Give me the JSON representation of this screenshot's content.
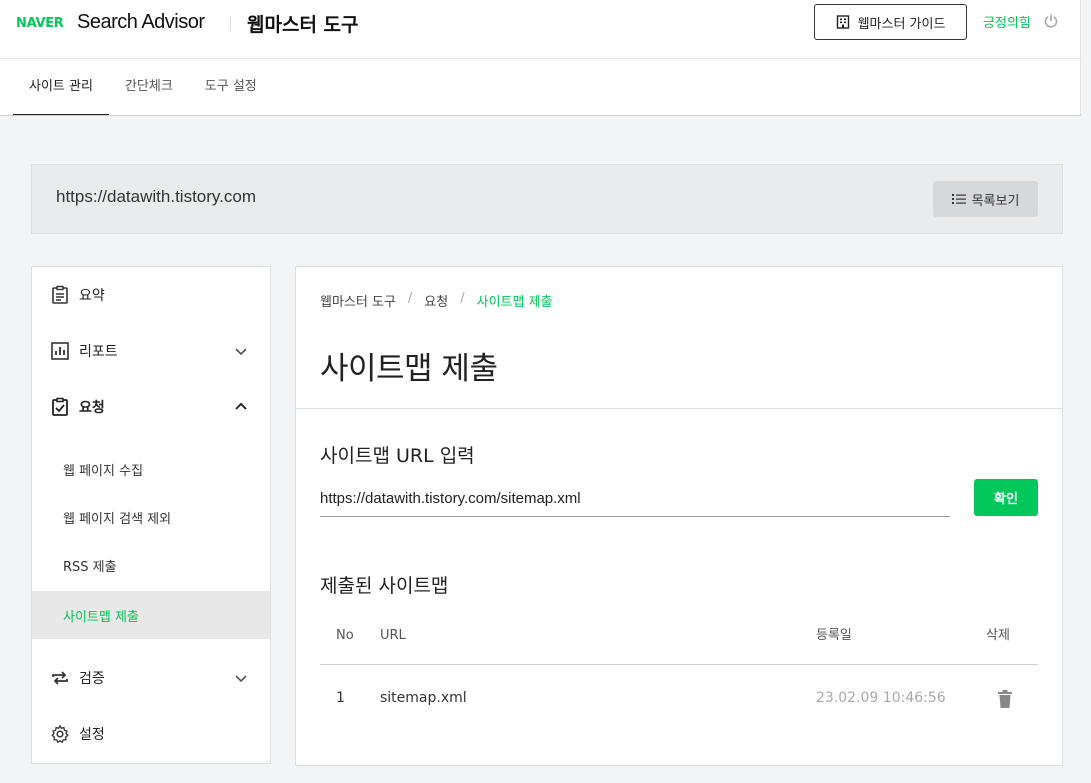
{
  "header": {
    "logo": "NAVER",
    "brand": "Search Advisor",
    "tool_title": "웹마스터 도구",
    "guide_button": "웹마스터 가이드",
    "user_name": "긍정의힘",
    "tabs": [
      {
        "label": "사이트 관리",
        "active": true
      },
      {
        "label": "간단체크",
        "active": false
      },
      {
        "label": "도구 설정",
        "active": false
      }
    ]
  },
  "site": {
    "url": "https://datawith.tistory.com",
    "list_button": "목록보기"
  },
  "sidebar": {
    "items": [
      {
        "label": "요약",
        "icon": "clipboard-icon"
      },
      {
        "label": "리포트",
        "icon": "bar-chart-icon",
        "expandable": true
      },
      {
        "label": "요청",
        "icon": "clipboard-check-icon",
        "expanded": true
      },
      {
        "label": "검증",
        "icon": "repeat-icon",
        "expandable": true
      },
      {
        "label": "설정",
        "icon": "gear-icon"
      }
    ],
    "subitems": [
      {
        "label": "웹 페이지 수집",
        "active": false
      },
      {
        "label": "웹 페이지 검색 제외",
        "active": false
      },
      {
        "label": "RSS 제출",
        "active": false
      },
      {
        "label": "사이트맵 제출",
        "active": true
      }
    ]
  },
  "breadcrumb": [
    "웹마스터 도구",
    "요청",
    "사이트맵 제출"
  ],
  "page_title": "사이트맵 제출",
  "sitemap_form": {
    "section_title": "사이트맵 URL 입력",
    "input_value": "https://datawith.tistory.com/sitemap.xml",
    "confirm_button": "확인"
  },
  "submitted": {
    "section_title": "제출된 사이트맵",
    "columns": [
      "No",
      "URL",
      "등록일",
      "삭제"
    ],
    "rows": [
      {
        "no": "1",
        "url": "sitemap.xml",
        "date": "23.02.09 10:46:56"
      }
    ]
  },
  "colors": {
    "accent": "#03c75a",
    "text": "#222222"
  }
}
